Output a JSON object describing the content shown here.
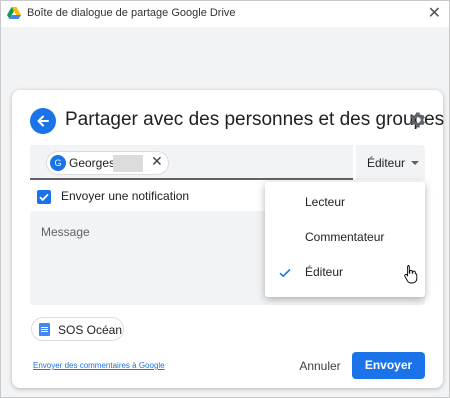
{
  "window": {
    "title": "Boîte de dialogue de partage Google Drive",
    "close_glyph": "✕"
  },
  "dialog": {
    "title": "Partager avec des personnes et des groupes",
    "recipient": {
      "initial": "G",
      "name": "Georges",
      "remove_glyph": "✕"
    },
    "role_button": {
      "label": "Éditeur"
    },
    "notification": {
      "label": "Envoyer une notification",
      "checked": true
    },
    "message": {
      "placeholder": "Message"
    },
    "document": {
      "name": "SOS Océan"
    },
    "feedback_link": "Envoyer des commentaires à Google",
    "cancel_label": "Annuler",
    "send_label": "Envoyer"
  },
  "role_menu": {
    "items": [
      {
        "label": "Lecteur",
        "selected": false
      },
      {
        "label": "Commentateur",
        "selected": false
      },
      {
        "label": "Éditeur",
        "selected": true
      }
    ]
  },
  "icons": {
    "back": "arrow-left-icon",
    "settings": "gear-icon",
    "check": "check-icon",
    "document": "google-docs-icon",
    "app": "google-drive-icon"
  },
  "colors": {
    "accent": "#1a73e8",
    "field_bg": "#f1f3f4",
    "text": "#202124"
  }
}
